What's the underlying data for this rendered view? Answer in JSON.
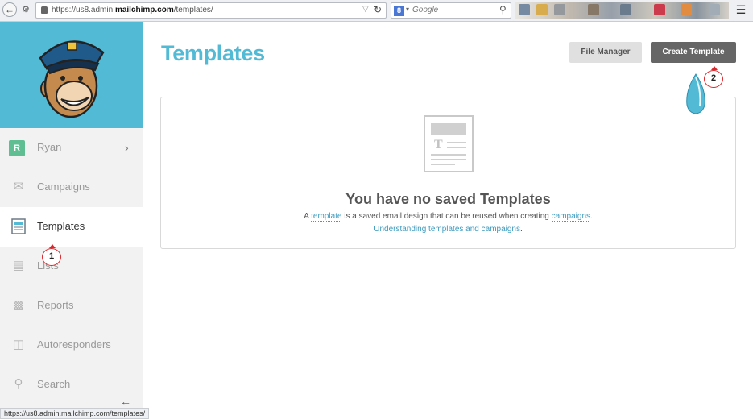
{
  "browser": {
    "url_prefix": "https://us8.admin.",
    "url_domain": "mailchimp.com",
    "url_path": "/templates/",
    "search_engine_letter": "8",
    "search_placeholder": "Google",
    "status_url": "https://us8.admin.mailchimp.com/templates/"
  },
  "sidebar": {
    "user": {
      "initial": "R",
      "name": "Ryan"
    },
    "items": [
      {
        "label": "Campaigns",
        "icon": "envelope-icon"
      },
      {
        "label": "Templates",
        "icon": "template-icon",
        "active": true
      },
      {
        "label": "Lists",
        "icon": "list-icon"
      },
      {
        "label": "Reports",
        "icon": "bar-chart-icon"
      },
      {
        "label": "Autoresponders",
        "icon": "autoresponder-icon"
      },
      {
        "label": "Search",
        "icon": "search-icon"
      }
    ]
  },
  "main": {
    "title": "Templates",
    "file_manager_label": "File Manager",
    "create_template_label": "Create Template",
    "empty_title": "You have no saved Templates",
    "empty_desc_prefix": "A",
    "empty_desc_link1": "template",
    "empty_desc_middle": "is a saved email design that can be reused when creating",
    "empty_desc_link2": "campaigns",
    "empty_desc_suffix": ".",
    "empty_help_link": "Understanding templates and campaigns",
    "empty_help_suffix": "."
  },
  "annotations": {
    "marker1": "1",
    "marker2": "2"
  },
  "colors": {
    "brand_blue": "#52bad5",
    "link": "#3e9bbf",
    "create_button": "#666666",
    "annotation_red": "#d9262b"
  }
}
